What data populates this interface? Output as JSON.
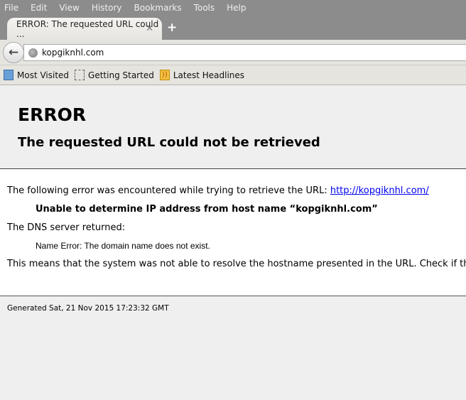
{
  "menu": [
    "File",
    "Edit",
    "View",
    "History",
    "Bookmarks",
    "Tools",
    "Help"
  ],
  "tab": {
    "title": "ERROR: The requested URL could ...",
    "close": "✕",
    "new_tab": "+"
  },
  "nav": {
    "back": "←",
    "url": "kopgiknhl.com"
  },
  "bookmarks": [
    {
      "label": "Most Visited",
      "icon": "most-visited-icon"
    },
    {
      "label": "Getting Started",
      "icon": "getting-started-icon"
    },
    {
      "label": "Latest Headlines",
      "icon": "rss-feed-icon"
    }
  ],
  "page": {
    "title": "ERROR",
    "subtitle": "The requested URL could not be retrieved",
    "intro": "The following error was encountered while trying to retrieve the URL: ",
    "link": "http://kopgiknhl.com/",
    "error": "Unable to determine IP address from host name “kopgiknhl.com”",
    "dns_label": "The DNS server returned:",
    "dns_message": "Name Error: The domain name does not exist.",
    "explanation": "This means that the system was not able to resolve the hostname presented in the URL. Check if the address is correct.",
    "footer": "Generated Sat, 21 Nov 2015 17:23:32 GMT"
  }
}
